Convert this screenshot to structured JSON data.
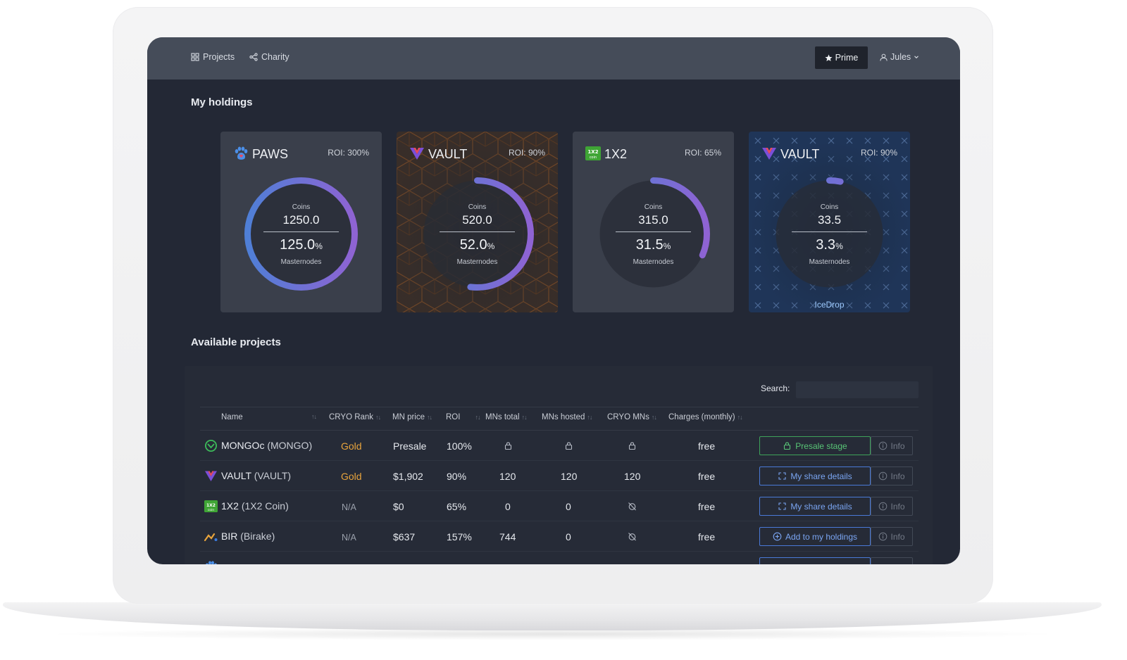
{
  "nav": {
    "projects_label": "Projects",
    "charity_label": "Charity",
    "prime_label": "Prime",
    "user_label": "Jules"
  },
  "holdings": {
    "title": "My holdings",
    "cards": [
      {
        "name": "PAWS",
        "roi": "ROI: 300%",
        "coins_label": "Coins",
        "coins": "1250.0",
        "mn_value": "125.0",
        "mn_unit": "%",
        "mn_label": "Masternodes",
        "progress": 1.0,
        "footer": ""
      },
      {
        "name": "VAULT",
        "roi": "ROI: 90%",
        "coins_label": "Coins",
        "coins": "520.0",
        "mn_value": "52.0",
        "mn_unit": "%",
        "mn_label": "Masternodes",
        "progress": 0.52,
        "footer": ""
      },
      {
        "name": "1X2",
        "roi": "ROI: 65%",
        "coins_label": "Coins",
        "coins": "315.0",
        "mn_value": "31.5",
        "mn_unit": "%",
        "mn_label": "Masternodes",
        "progress": 0.315,
        "footer": ""
      },
      {
        "name": "VAULT",
        "roi": "ROI: 90%",
        "coins_label": "Coins",
        "coins": "33.5",
        "mn_value": "3.3",
        "mn_unit": "%",
        "mn_label": "Masternodes",
        "progress": 0.033,
        "footer": "IceDrop"
      }
    ]
  },
  "projects": {
    "title": "Available projects",
    "search_label": "Search:",
    "search_value": "",
    "columns": [
      "Name",
      "CRYO Rank",
      "MN price",
      "ROI",
      "MNs total",
      "MNs hosted",
      "CRYO MNs",
      "Charges (monthly)"
    ],
    "info_label": "Info",
    "rows": [
      {
        "name": "MONGOc",
        "ticker": "(MONGO)",
        "rank": "Gold",
        "price": "Presale",
        "roi": "100%",
        "mns_total": "",
        "mns_hosted": "",
        "cryo_mns": "",
        "charges": "free",
        "action": "Presale stage"
      },
      {
        "name": "VAULT",
        "ticker": "(VAULT)",
        "rank": "Gold",
        "price": "$1,902",
        "roi": "90%",
        "mns_total": "120",
        "mns_hosted": "120",
        "cryo_mns": "120",
        "charges": "free",
        "action": "My share details"
      },
      {
        "name": "1X2",
        "ticker": "(1X2 Coin)",
        "rank": "N/A",
        "price": "$0",
        "roi": "65%",
        "mns_total": "0",
        "mns_hosted": "0",
        "cryo_mns": "",
        "charges": "free",
        "action": "My share details"
      },
      {
        "name": "BIR",
        "ticker": "(Birake)",
        "rank": "N/A",
        "price": "$637",
        "roi": "157%",
        "mns_total": "744",
        "mns_hosted": "0",
        "cryo_mns": "",
        "charges": "free",
        "action": "Add to my holdings"
      }
    ]
  },
  "colors": {
    "screen_bg": "#232835",
    "nav_bg": "#454c59",
    "gold": "#e8a43c",
    "accent_blue": "#4a7ad8",
    "accent_green": "#3fa35a"
  }
}
